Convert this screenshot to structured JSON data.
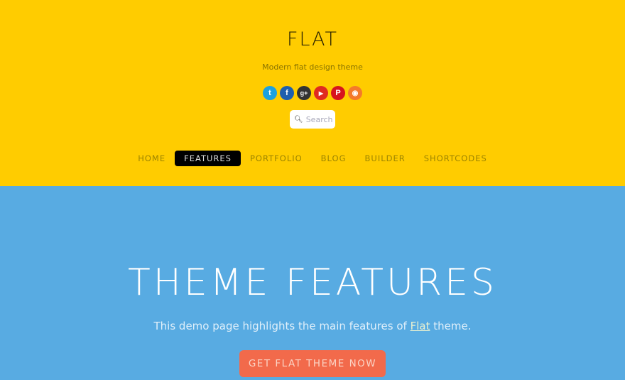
{
  "header": {
    "site_title": "FLAT",
    "tagline": "Modern flat design theme",
    "background_color": "#FFCC00"
  },
  "social": [
    {
      "name": "twitter",
      "glyph": "t",
      "color": "#1DA1E0"
    },
    {
      "name": "facebook",
      "glyph": "f",
      "color": "#1E5FAE"
    },
    {
      "name": "google-plus",
      "glyph": "g+",
      "color": "#333333"
    },
    {
      "name": "youtube",
      "glyph": "▶",
      "color": "#E02A20"
    },
    {
      "name": "pinterest",
      "glyph": "P",
      "color": "#D7141E"
    },
    {
      "name": "rss",
      "glyph": "◉",
      "color": "#F47A2A"
    }
  ],
  "search": {
    "placeholder": "Search",
    "icon": "search-icon"
  },
  "nav": {
    "items": [
      {
        "label": "HOME",
        "active": false
      },
      {
        "label": "FEATURES",
        "active": true
      },
      {
        "label": "PORTFOLIO",
        "active": false
      },
      {
        "label": "BLOG",
        "active": false
      },
      {
        "label": "BUILDER",
        "active": false
      },
      {
        "label": "SHORTCODES",
        "active": false
      }
    ]
  },
  "hero": {
    "title": "THEME FEATURES",
    "lead_before": "This demo page highlights the main features of ",
    "lead_link": "Flat",
    "lead_after": " theme.",
    "cta_label": "GET FLAT THEME NOW",
    "background_color": "#58ABE2",
    "cta_color": "#F26A4B"
  }
}
